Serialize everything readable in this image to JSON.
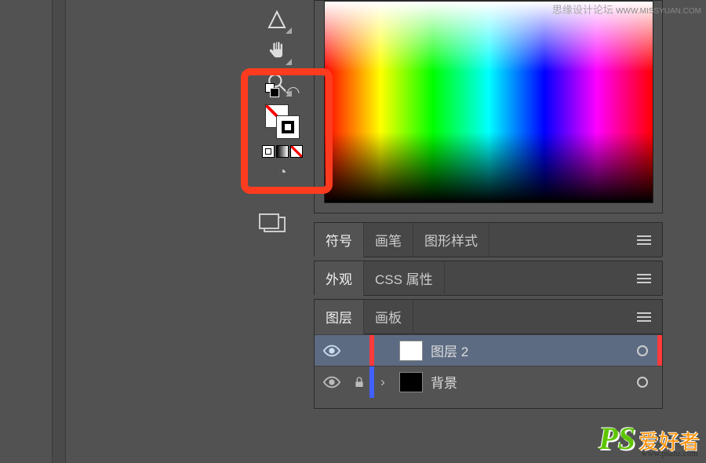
{
  "watermarks": {
    "top_text": "思缘设计论坛",
    "top_url": "WWW.MISSYUAN.COM",
    "bottom_ps": "PS",
    "bottom_text": "爱好者",
    "bottom_url": "www.psahz.com"
  },
  "tools": {
    "triangle": "triangle-icon",
    "hand": "✋",
    "zoom": "🔍",
    "default_swap": "↶",
    "draw_mode": "◔",
    "screen": "screen-icon"
  },
  "panel_symbols": {
    "tab1": "符号",
    "tab2": "画笔",
    "tab3": "图形样式"
  },
  "panel_appearance": {
    "tab1": "外观",
    "tab2": "CSS 属性"
  },
  "panel_layers": {
    "tab1": "图层",
    "tab2": "画板",
    "layers": [
      {
        "name": "图层 2",
        "selected": true,
        "color": "#ff3b3b",
        "thumb": "white",
        "locked": false
      },
      {
        "name": "背景",
        "selected": false,
        "color": "#4060ff",
        "thumb": "black",
        "locked": true
      }
    ]
  }
}
